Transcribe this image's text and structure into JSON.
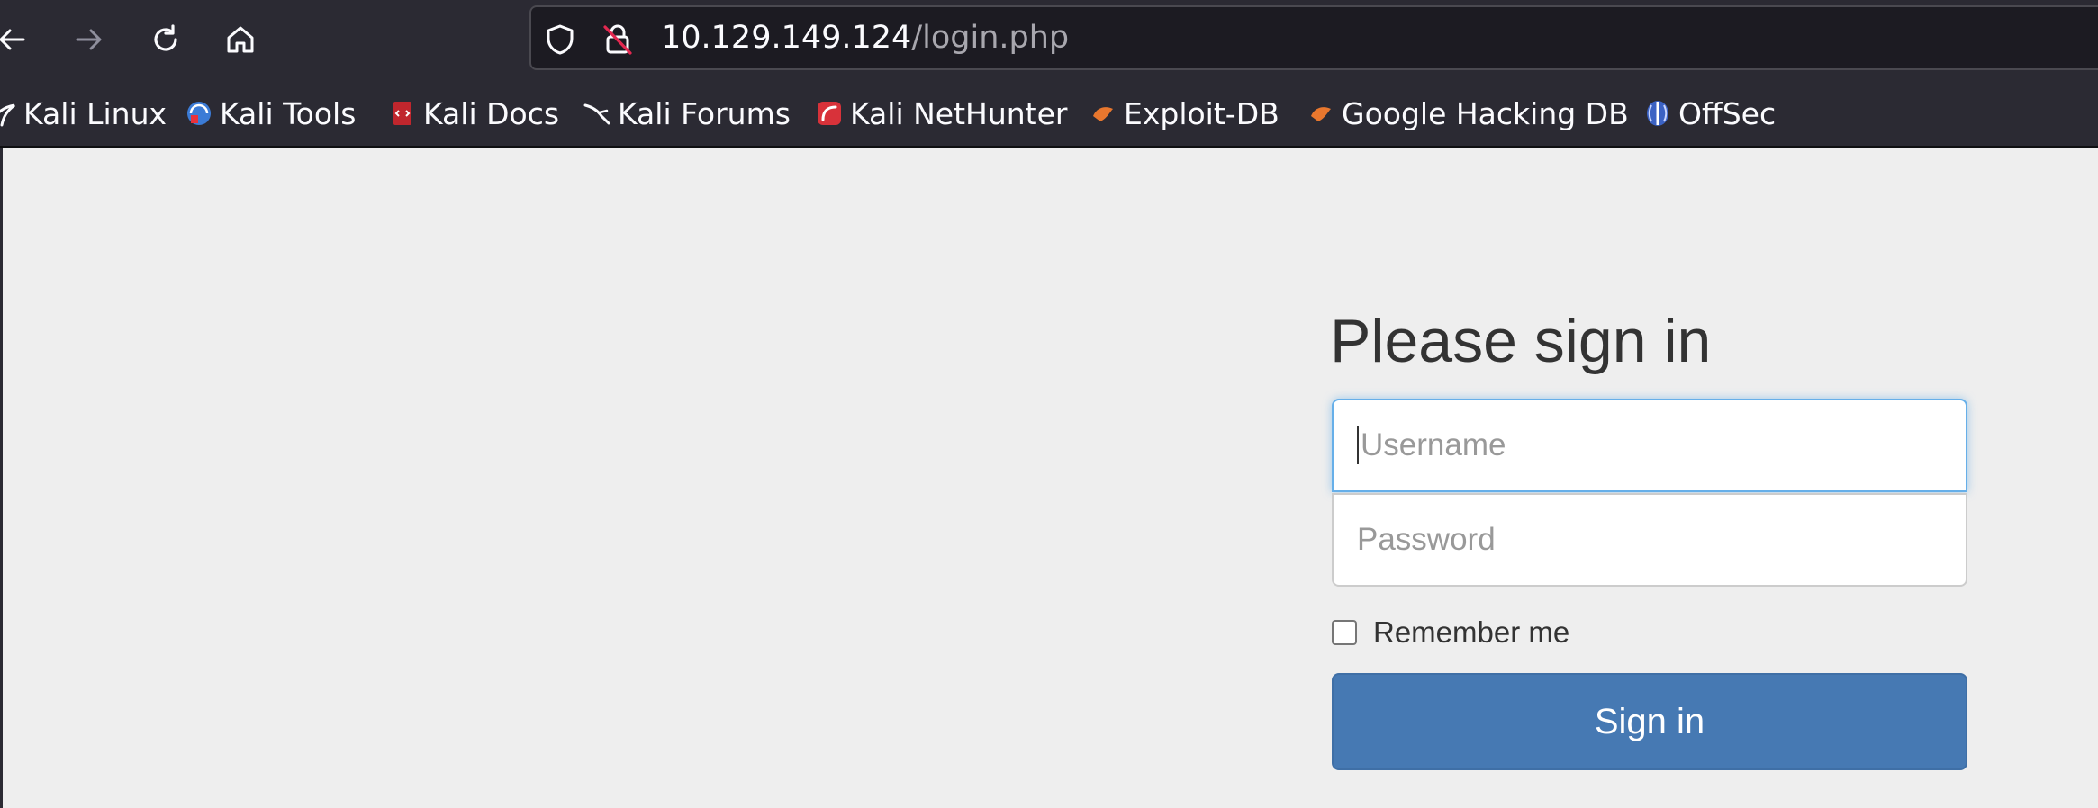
{
  "browser": {
    "nav": {
      "back_icon": "arrow-left-icon",
      "forward_icon": "arrow-right-icon",
      "reload_icon": "reload-icon",
      "home_icon": "home-icon"
    },
    "url": {
      "host": "10.129.149.124",
      "path": "/login.php",
      "tracking_icon": "shield-icon",
      "security_icon": "insecure-lock-icon"
    },
    "bookmarks": [
      {
        "label": "Kali Linux",
        "icon": "kali-dragon-icon"
      },
      {
        "label": "Kali Tools",
        "icon": "kali-tools-icon"
      },
      {
        "label": "Kali Docs",
        "icon": "kali-docs-icon"
      },
      {
        "label": "Kali Forums",
        "icon": "kali-forums-icon"
      },
      {
        "label": "Kali NetHunter",
        "icon": "nethunter-icon"
      },
      {
        "label": "Exploit-DB",
        "icon": "exploit-db-icon"
      },
      {
        "label": "Google Hacking DB",
        "icon": "ghdb-icon"
      },
      {
        "label": "OffSec",
        "icon": "offsec-icon"
      }
    ]
  },
  "login": {
    "heading": "Please sign in",
    "username_placeholder": "Username",
    "password_placeholder": "Password",
    "remember_label": "Remember me",
    "remember_checked": false,
    "submit_label": "Sign in"
  },
  "colors": {
    "toolbar": "#2b2a33",
    "page_bg": "#eeeeee",
    "button": "#4679b3",
    "focus": "#66afe9"
  }
}
